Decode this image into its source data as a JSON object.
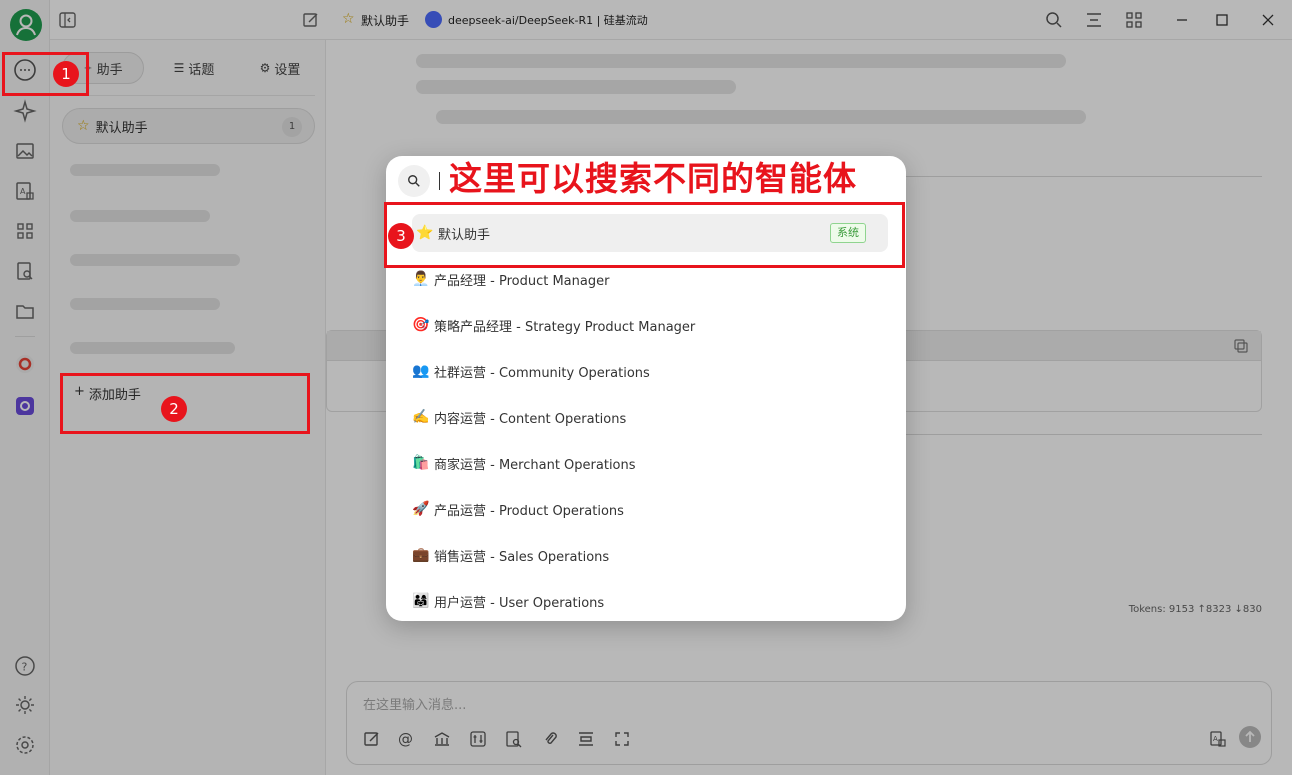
{
  "titlebar": {
    "assistant_title": "默认助手",
    "model_title": "deepseek-ai/DeepSeek-R1 | 硅基流动"
  },
  "sidebar": {
    "tabs": [
      {
        "label": "助手",
        "icon": "assistant-icon"
      },
      {
        "label": "话题",
        "icon": "list-icon"
      },
      {
        "label": "设置",
        "icon": "gear-icon"
      }
    ],
    "assistant": {
      "name": "默认助手",
      "count": "1"
    },
    "add_label": "添加助手"
  },
  "main": {
    "tokens": "Tokens: 9153 ↑8323 ↓830",
    "input_placeholder": "在这里输入消息..."
  },
  "popup": {
    "callout": "这里可以搜索不同的智能体",
    "items": [
      {
        "emoji": "⭐",
        "label": "默认助手",
        "badge": "系统"
      },
      {
        "emoji": "👨‍💼",
        "label": "产品经理 - Product Manager"
      },
      {
        "emoji": "🎯",
        "label": "策略产品经理 - Strategy Product Manager"
      },
      {
        "emoji": "👥",
        "label": "社群运营 - Community Operations"
      },
      {
        "emoji": "✍️",
        "label": "内容运营 - Content Operations"
      },
      {
        "emoji": "🛍️",
        "label": "商家运营 - Merchant Operations"
      },
      {
        "emoji": "🚀",
        "label": "产品运营 - Product Operations"
      },
      {
        "emoji": "💼",
        "label": "销售运营 - Sales Operations"
      },
      {
        "emoji": "👨‍👩‍👧",
        "label": "用户运营 - User Operations"
      }
    ]
  },
  "annotations": {
    "n1": "1",
    "n2": "2",
    "n3": "3"
  },
  "colors": {
    "annotation_red": "#e8141c",
    "system_badge_green": "#3b9b3b",
    "avatar_green": "#1f9d4f"
  }
}
